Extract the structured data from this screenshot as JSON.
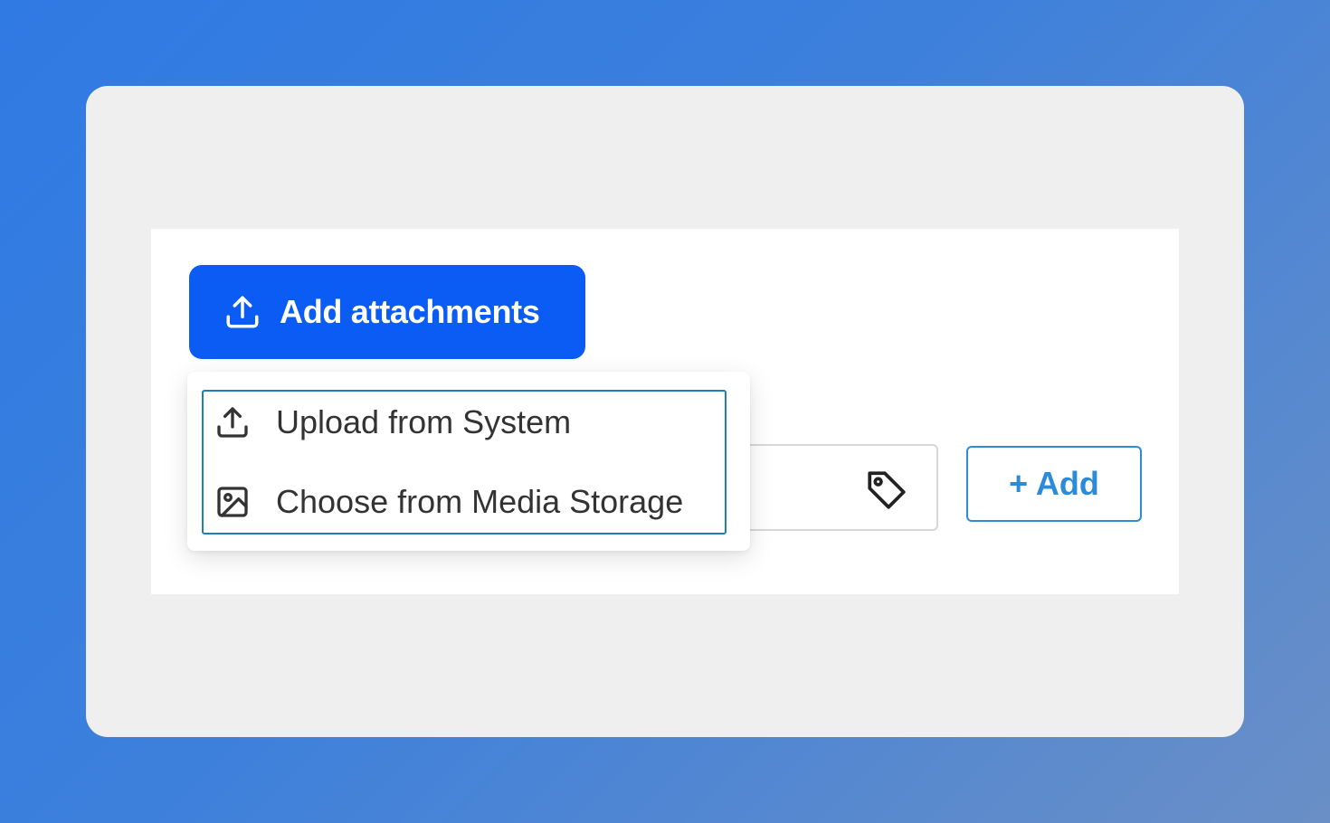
{
  "attach_button": {
    "label": "Add attachments",
    "icon": "upload-icon",
    "color": "#0b5cf5"
  },
  "dropdown": {
    "items": [
      {
        "label": "Upload from System",
        "icon": "upload-icon"
      },
      {
        "label": "Choose from Media Storage",
        "icon": "image-icon"
      }
    ],
    "border_color": "#1f7fb8"
  },
  "tag_field": {
    "icon": "tag-icon"
  },
  "add_button": {
    "label": "+ Add",
    "color": "#2a8bd8"
  }
}
